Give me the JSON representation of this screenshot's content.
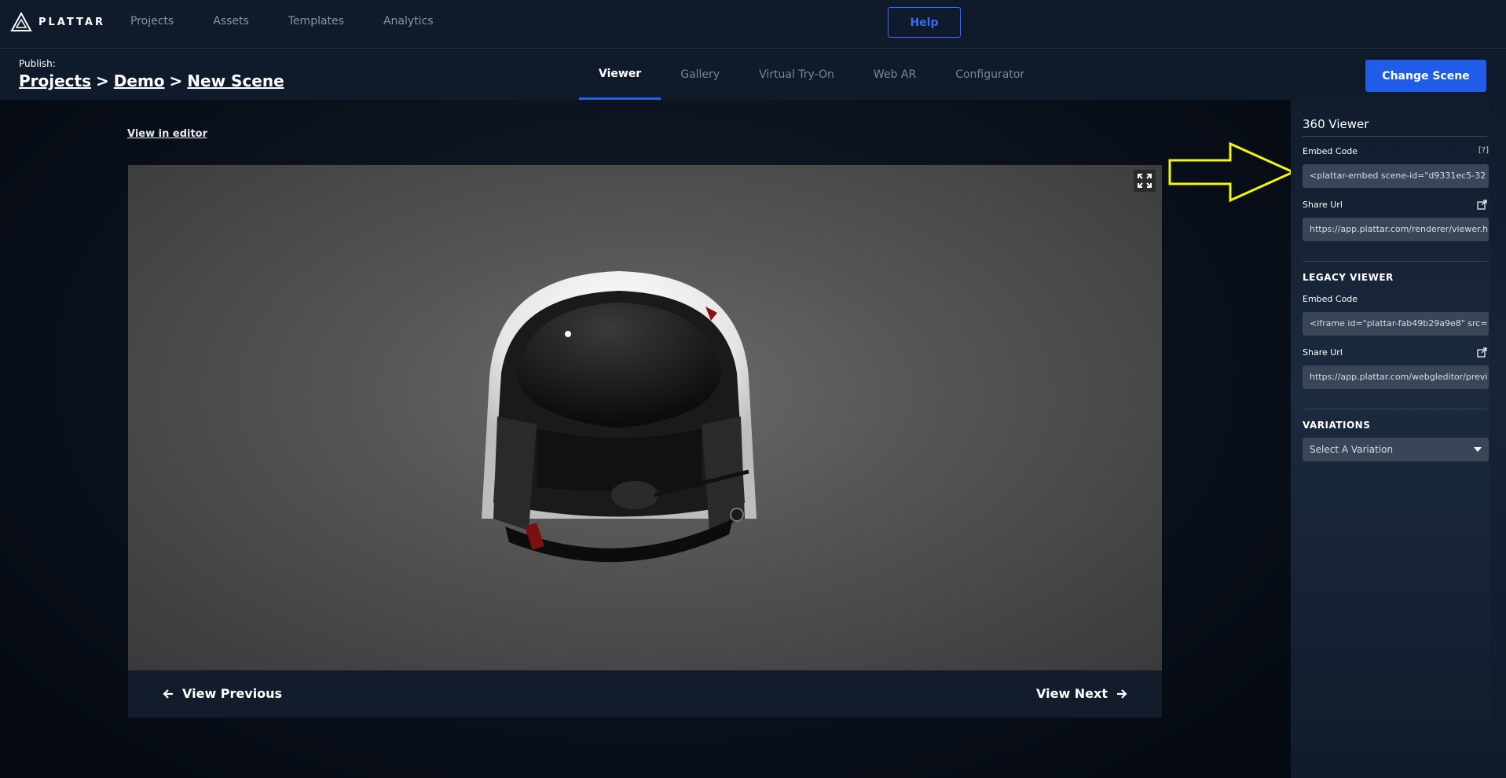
{
  "brand": {
    "name": "PLATTAR"
  },
  "nav": {
    "items": [
      "Projects",
      "Assets",
      "Templates",
      "Analytics"
    ],
    "help_label": "Help"
  },
  "subheader": {
    "publish_label": "Publish:",
    "breadcrumb": [
      "Projects",
      "Demo",
      "New Scene"
    ],
    "separator": ">",
    "tabs": [
      "Viewer",
      "Gallery",
      "Virtual Try-On",
      "Web AR",
      "Configurator"
    ],
    "active_tab": "Viewer",
    "change_scene_label": "Change Scene"
  },
  "main": {
    "view_in_editor": "View in editor",
    "prev_label": "View Previous",
    "next_label": "View Next"
  },
  "sidebar": {
    "viewer_title": "360 Viewer",
    "embed_label": "Embed Code",
    "help_marker": "[?]",
    "embed_value": "<plattar-embed scene-id=\"d9331ec5-32",
    "share_label": "Share Url",
    "share_value": "https://app.plattar.com/renderer/viewer.h",
    "legacy_title": "LEGACY VIEWER",
    "legacy_embed_label": "Embed Code",
    "legacy_embed_value": "<iframe id=\"plattar-fab49b29a9e8\" src=",
    "legacy_share_label": "Share Url",
    "legacy_share_value": "https://app.plattar.com/webgleditor/previ",
    "variations_title": "VARIATIONS",
    "variation_select": "Select A Variation"
  },
  "colors": {
    "accent": "#1f5ce8",
    "annotation_arrow": "#f5f50a"
  }
}
